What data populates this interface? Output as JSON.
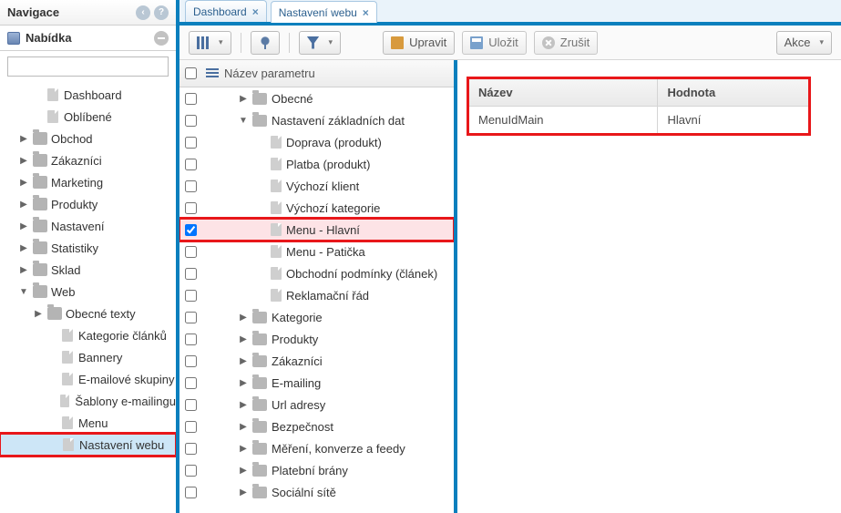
{
  "sidebar": {
    "header": "Navigace",
    "menu_title": "Nabídka",
    "search_value": "",
    "items": [
      {
        "type": "doc",
        "level": 2,
        "label": "Dashboard"
      },
      {
        "type": "doc",
        "level": 2,
        "label": "Oblíbené"
      },
      {
        "type": "folder",
        "level": 1,
        "label": "Obchod",
        "arrow": "right"
      },
      {
        "type": "folder",
        "level": 1,
        "label": "Zákazníci",
        "arrow": "right"
      },
      {
        "type": "folder",
        "level": 1,
        "label": "Marketing",
        "arrow": "right"
      },
      {
        "type": "folder",
        "level": 1,
        "label": "Produkty",
        "arrow": "right"
      },
      {
        "type": "folder",
        "level": 1,
        "label": "Nastavení",
        "arrow": "right"
      },
      {
        "type": "folder",
        "level": 1,
        "label": "Statistiky",
        "arrow": "right"
      },
      {
        "type": "folder",
        "level": 1,
        "label": "Sklad",
        "arrow": "right"
      },
      {
        "type": "folder",
        "level": 1,
        "label": "Web",
        "arrow": "down"
      },
      {
        "type": "folder",
        "level": 2,
        "label": "Obecné texty",
        "arrow": "right"
      },
      {
        "type": "doc",
        "level": 3,
        "label": "Kategorie článků"
      },
      {
        "type": "doc",
        "level": 3,
        "label": "Bannery"
      },
      {
        "type": "doc",
        "level": 3,
        "label": "E-mailové skupiny"
      },
      {
        "type": "doc",
        "level": 3,
        "label": "Šablony e-mailingu"
      },
      {
        "type": "doc",
        "level": 3,
        "label": "Menu"
      },
      {
        "type": "doc",
        "level": 3,
        "label": "Nastavení webu",
        "selected": true,
        "highlighted": true
      }
    ]
  },
  "tabs": [
    {
      "label": "Dashboard",
      "active": false
    },
    {
      "label": "Nastavení webu",
      "active": true
    }
  ],
  "toolbar": {
    "edit": "Upravit",
    "save": "Uložit",
    "cancel": "Zrušit",
    "actions": "Akce"
  },
  "grid": {
    "header": "Název parametru",
    "rows": [
      {
        "type": "folder",
        "level": 1,
        "arrow": "right",
        "label": "Obecné"
      },
      {
        "type": "folder",
        "level": 1,
        "arrow": "down",
        "label": "Nastavení základních dat"
      },
      {
        "type": "doc",
        "level": 2,
        "label": "Doprava (produkt)"
      },
      {
        "type": "doc",
        "level": 2,
        "label": "Platba (produkt)"
      },
      {
        "type": "doc",
        "level": 2,
        "label": "Výchozí klient"
      },
      {
        "type": "doc",
        "level": 2,
        "label": "Výchozí kategorie"
      },
      {
        "type": "doc",
        "level": 2,
        "label": "Menu - Hlavní",
        "checked": true,
        "selected": true,
        "highlighted": true
      },
      {
        "type": "doc",
        "level": 2,
        "label": "Menu - Patička"
      },
      {
        "type": "doc",
        "level": 2,
        "label": "Obchodní podmínky (článek)"
      },
      {
        "type": "doc",
        "level": 2,
        "label": "Reklamační řád"
      },
      {
        "type": "folder",
        "level": 1,
        "arrow": "right",
        "label": "Kategorie"
      },
      {
        "type": "folder",
        "level": 1,
        "arrow": "right",
        "label": "Produkty"
      },
      {
        "type": "folder",
        "level": 1,
        "arrow": "right",
        "label": "Zákazníci"
      },
      {
        "type": "folder",
        "level": 1,
        "arrow": "right",
        "label": "E-mailing"
      },
      {
        "type": "folder",
        "level": 1,
        "arrow": "right",
        "label": "Url adresy"
      },
      {
        "type": "folder",
        "level": 1,
        "arrow": "right",
        "label": "Bezpečnost"
      },
      {
        "type": "folder",
        "level": 1,
        "arrow": "right",
        "label": "Měření, konverze a feedy"
      },
      {
        "type": "folder",
        "level": 1,
        "arrow": "right",
        "label": "Platební brány"
      },
      {
        "type": "folder",
        "level": 1,
        "arrow": "right",
        "label": "Sociální sítě"
      }
    ]
  },
  "details": {
    "cols": [
      "Název",
      "Hodnota"
    ],
    "rows": [
      {
        "name": "MenuIdMain",
        "value": "Hlavní"
      }
    ]
  }
}
